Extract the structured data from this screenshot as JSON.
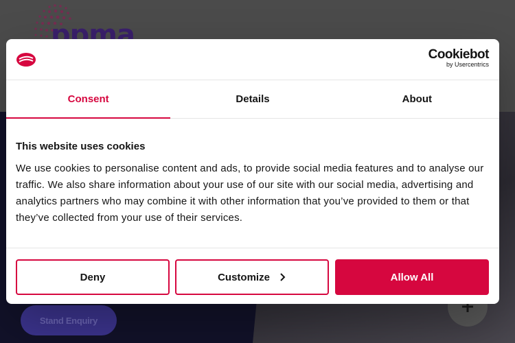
{
  "background": {
    "logo_text": "ppma",
    "enquiry_button": "Stand Enquiry",
    "plus_icon": "plus-icon"
  },
  "cookie_dialog": {
    "brand_icon": "site-logo-icon",
    "cookiebot_logo": "Cookiebot",
    "cookiebot_sub": "by Usercentrics",
    "tabs": [
      {
        "label": "Consent",
        "active": true
      },
      {
        "label": "Details",
        "active": false
      },
      {
        "label": "About",
        "active": false
      }
    ],
    "title": "This website uses cookies",
    "text": "We use cookies to personalise content and ads, to provide social media features and to analyse our traffic. We also share information about your use of our site with our social media, advertising and analytics partners who may combine it with other information that you’ve provided to them or that they’ve collected from your use of their services.",
    "buttons": {
      "deny": "Deny",
      "customize": "Customize",
      "allow": "Allow All"
    },
    "colors": {
      "accent": "#d6073f",
      "text": "#141414"
    }
  }
}
